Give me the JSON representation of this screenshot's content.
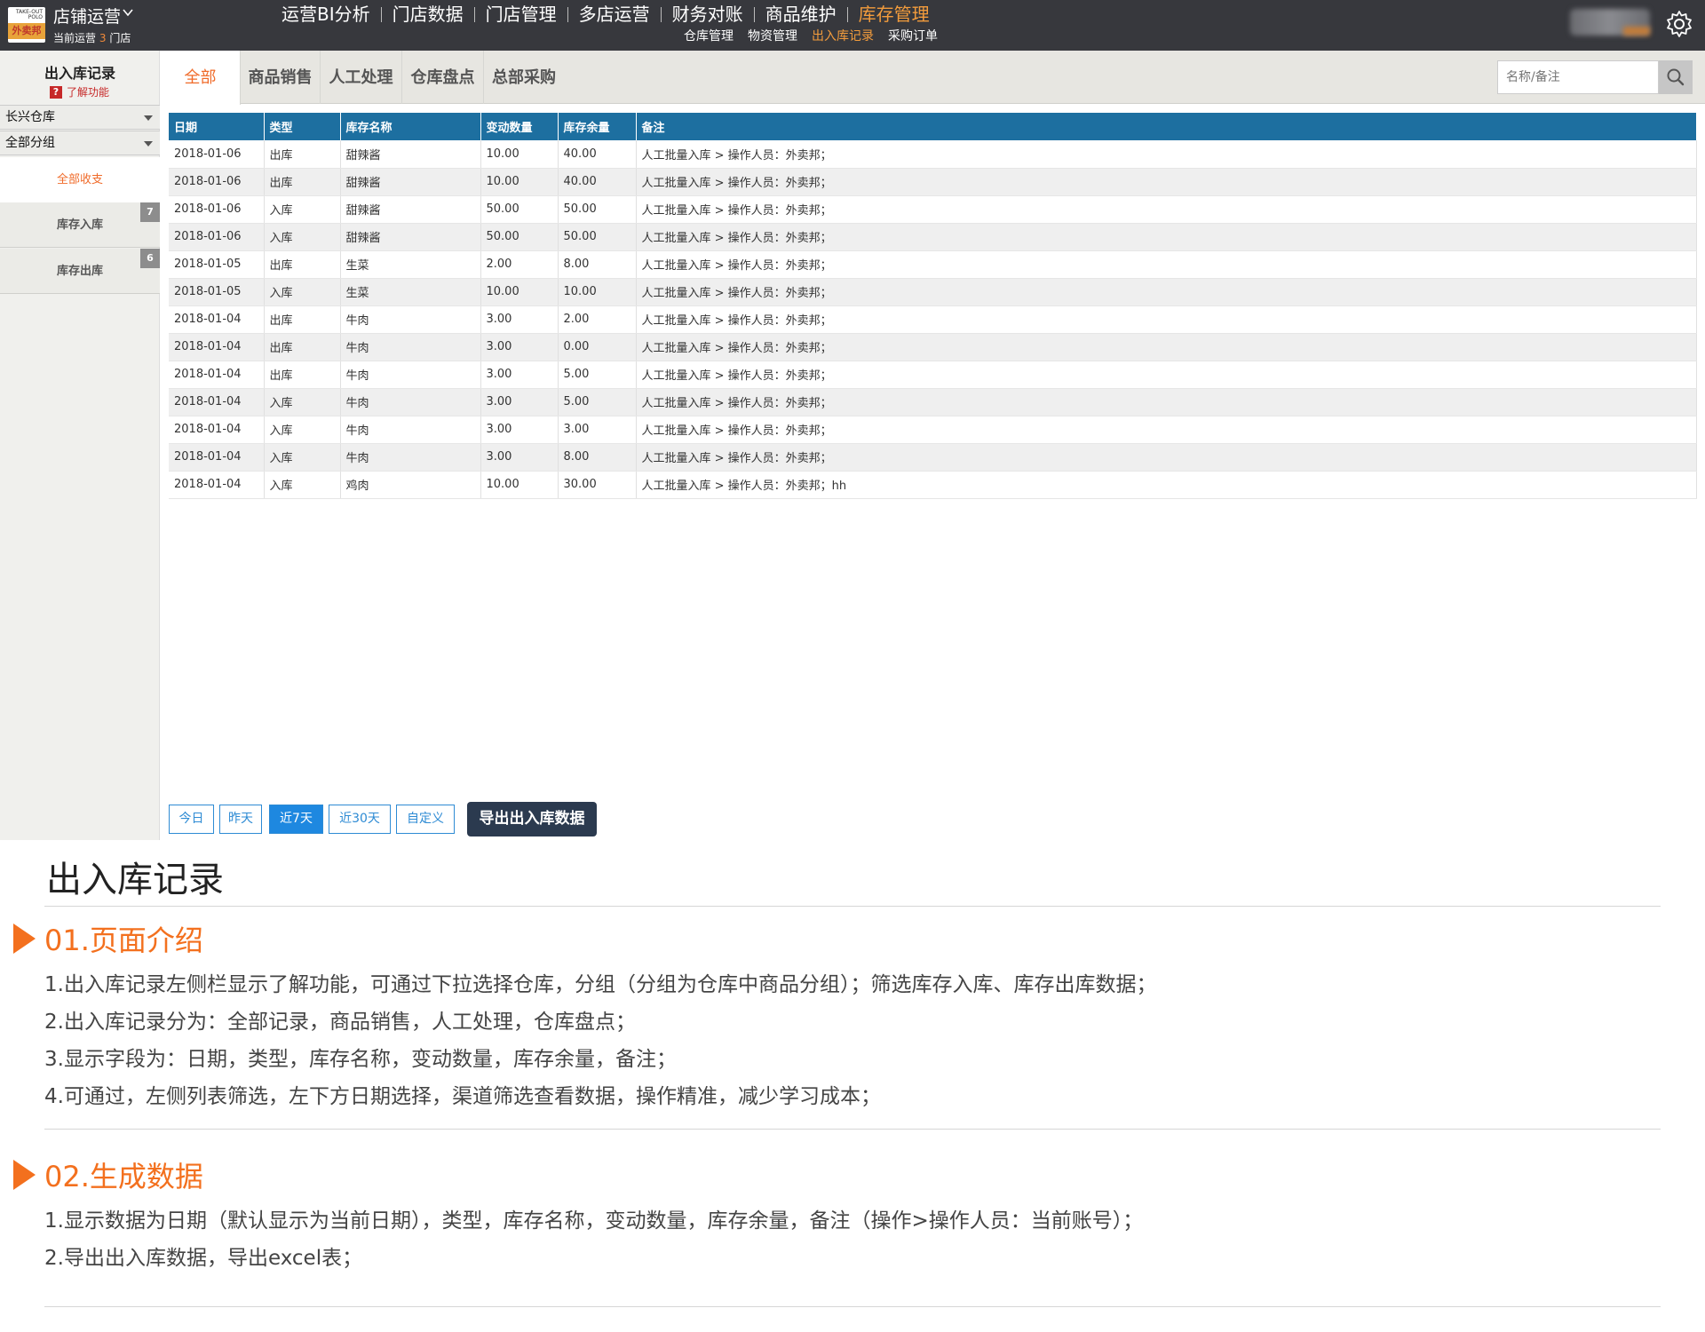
{
  "header": {
    "logo_top": "TAKE-OUT POLO",
    "logo_text": "外卖邦",
    "store_name": "店铺运营",
    "store_sub_prefix": "当前运营",
    "store_count": "3",
    "store_sub_suffix": "门店",
    "nav": [
      "运营BI分析",
      "门店数据",
      "门店管理",
      "多店运营",
      "财务对账",
      "商品维护",
      "库存管理"
    ],
    "subnav": [
      "仓库管理",
      "物资管理",
      "出入库记录",
      "采购订单"
    ],
    "accent": "#f39c3c"
  },
  "sidebar": {
    "title": "出入库记录",
    "help": "了解功能",
    "warehouse": "长兴仓库",
    "group": "全部分组",
    "items": [
      {
        "label": "全部收支",
        "badge": ""
      },
      {
        "label": "库存入库",
        "badge": "7"
      },
      {
        "label": "库存出库",
        "badge": "6"
      }
    ]
  },
  "tabs": [
    "全部",
    "商品销售",
    "人工处理",
    "仓库盘点",
    "总部采购"
  ],
  "search": {
    "placeholder": "名称/备注"
  },
  "table": {
    "columns": [
      "日期",
      "类型",
      "库存名称",
      "变动数量",
      "库存余量",
      "备注"
    ],
    "rows": [
      [
        "2018-01-06",
        "出库",
        "甜辣酱",
        "10.00",
        "40.00",
        "人工批量入库 > 操作人员：外卖邦；"
      ],
      [
        "2018-01-06",
        "出库",
        "甜辣酱",
        "10.00",
        "40.00",
        "人工批量入库 > 操作人员：外卖邦；"
      ],
      [
        "2018-01-06",
        "入库",
        "甜辣酱",
        "50.00",
        "50.00",
        "人工批量入库 > 操作人员：外卖邦；"
      ],
      [
        "2018-01-06",
        "入库",
        "甜辣酱",
        "50.00",
        "50.00",
        "人工批量入库 > 操作人员：外卖邦；"
      ],
      [
        "2018-01-05",
        "出库",
        "生菜",
        "2.00",
        "8.00",
        "人工批量入库 > 操作人员：外卖邦；"
      ],
      [
        "2018-01-05",
        "入库",
        "生菜",
        "10.00",
        "10.00",
        "人工批量入库 > 操作人员：外卖邦；"
      ],
      [
        "2018-01-04",
        "出库",
        "牛肉",
        "3.00",
        "2.00",
        "人工批量入库 > 操作人员：外卖邦；"
      ],
      [
        "2018-01-04",
        "出库",
        "牛肉",
        "3.00",
        "0.00",
        "人工批量入库 > 操作人员：外卖邦；"
      ],
      [
        "2018-01-04",
        "出库",
        "牛肉",
        "3.00",
        "5.00",
        "人工批量入库 > 操作人员：外卖邦；"
      ],
      [
        "2018-01-04",
        "入库",
        "牛肉",
        "3.00",
        "5.00",
        "人工批量入库 > 操作人员：外卖邦；"
      ],
      [
        "2018-01-04",
        "入库",
        "牛肉",
        "3.00",
        "3.00",
        "人工批量入库 > 操作人员：外卖邦；"
      ],
      [
        "2018-01-04",
        "入库",
        "牛肉",
        "3.00",
        "8.00",
        "人工批量入库 > 操作人员：外卖邦；"
      ],
      [
        "2018-01-04",
        "入库",
        "鸡肉",
        "10.00",
        "30.00",
        "人工批量入库 > 操作人员：外卖邦；hh"
      ]
    ]
  },
  "date_buttons": [
    "今日",
    "昨天",
    "近7天",
    "近30天",
    "自定义"
  ],
  "export_label": "导出出入库数据",
  "doc": {
    "title": "出入库记录",
    "section1": {
      "heading": "01.页面介绍",
      "lines": [
        "1.出入库记录左侧栏显示了解功能，可通过下拉选择仓库，分组（分组为仓库中商品分组）；筛选库存入库、库存出库数据；",
        "2.出入库记录分为：全部记录，商品销售，人工处理，仓库盘点；",
        "3.显示字段为：日期，类型，库存名称，变动数量，库存余量，备注；",
        "4.可通过，左侧列表筛选，左下方日期选择，渠道筛选查看数据，操作精准，减少学习成本；"
      ]
    },
    "section2": {
      "heading": "02.生成数据",
      "lines": [
        "1.显示数据为日期（默认显示为当前日期），类型，库存名称，变动数量，库存余量，备注（操作>操作人员：当前账号）；",
        "2.导出出入库数据，导出excel表；"
      ]
    }
  }
}
